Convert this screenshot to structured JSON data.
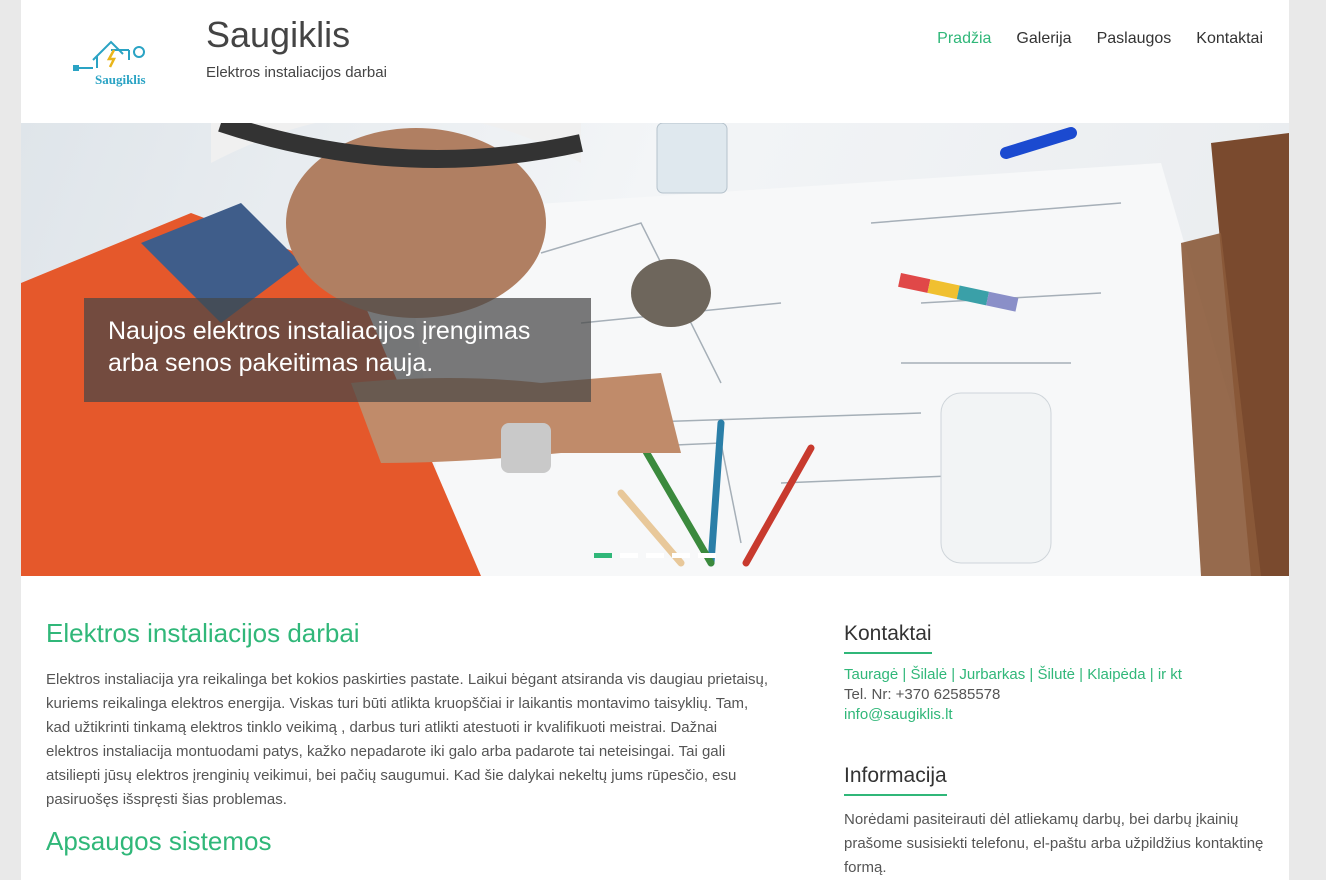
{
  "header": {
    "logo_text": "Saugiklis",
    "site_title": "Saugiklis",
    "site_description": "Elektros instaliacijos darbai"
  },
  "nav": {
    "items": [
      {
        "label": "Pradžia"
      },
      {
        "label": "Galerija"
      },
      {
        "label": "Paslaugos"
      },
      {
        "label": "Kontaktai"
      }
    ]
  },
  "slider": {
    "caption_line1": "Naujos elektros instaliacijos įrengimas",
    "caption_line2": "arba senos pakeitimas nauja.",
    "slide_count": 5,
    "active_slide": 1
  },
  "main": {
    "title": "Elektros instaliacijos darbai",
    "text": "Elektros instaliacija yra reikalinga bet kokios paskirties pastate. Laikui bėgant atsiranda vis daugiau prietaisų, kuriems reikalinga elektros energija. Viskas turi būti atlikta kruopščiai ir laikantis montavimo taisyklių. Tam, kad užtikrinti tinkamą elektros tinklo veikimą , darbus turi atlikti atestuoti ir kvalifikuoti meistrai. Dažnai elektros instaliacija montuodami patys, kažko nepadarote iki galo arba padarote tai neteisingai. Tai gali atsiliepti jūsų elektros įrenginių veikimui, bei pačių saugumui. Kad šie dalykai nekeltų jums rūpesčio, esu pasiruošęs išspręsti šias problemas.",
    "subtitle": "Apsaugos sistemos"
  },
  "sidebar": {
    "contacts_title": "Kontaktai",
    "locations": "Tauragė | Šilalė | Jurbarkas | Šilutė | Klaipėda | ir kt",
    "phone": "Tel. Nr: +370 62585578",
    "email": "info@saugiklis.lt",
    "info_title": "Informacija",
    "info_text": "Norėdami pasiteirauti dėl atliekamų darbų, bei darbų įkainių prašome susisiekti telefonu, el-paštu arba užpildžius kontaktinę formą."
  },
  "colors": {
    "accent": "#30b779",
    "text": "#555555",
    "background": "#e9e9e9"
  }
}
